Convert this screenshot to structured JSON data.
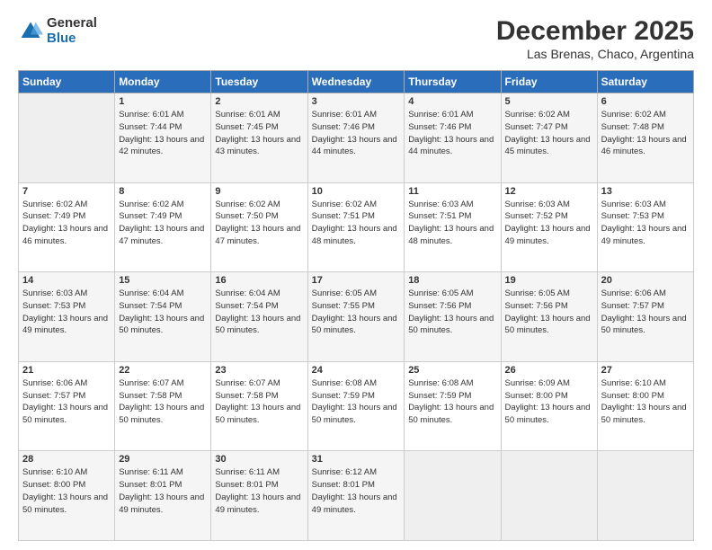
{
  "logo": {
    "general": "General",
    "blue": "Blue"
  },
  "title": "December 2025",
  "location": "Las Brenas, Chaco, Argentina",
  "days_of_week": [
    "Sunday",
    "Monday",
    "Tuesday",
    "Wednesday",
    "Thursday",
    "Friday",
    "Saturday"
  ],
  "weeks": [
    [
      {
        "day": "",
        "sunrise": "",
        "sunset": "",
        "daylight": ""
      },
      {
        "day": "1",
        "sunrise": "Sunrise: 6:01 AM",
        "sunset": "Sunset: 7:44 PM",
        "daylight": "Daylight: 13 hours and 42 minutes."
      },
      {
        "day": "2",
        "sunrise": "Sunrise: 6:01 AM",
        "sunset": "Sunset: 7:45 PM",
        "daylight": "Daylight: 13 hours and 43 minutes."
      },
      {
        "day": "3",
        "sunrise": "Sunrise: 6:01 AM",
        "sunset": "Sunset: 7:46 PM",
        "daylight": "Daylight: 13 hours and 44 minutes."
      },
      {
        "day": "4",
        "sunrise": "Sunrise: 6:01 AM",
        "sunset": "Sunset: 7:46 PM",
        "daylight": "Daylight: 13 hours and 44 minutes."
      },
      {
        "day": "5",
        "sunrise": "Sunrise: 6:02 AM",
        "sunset": "Sunset: 7:47 PM",
        "daylight": "Daylight: 13 hours and 45 minutes."
      },
      {
        "day": "6",
        "sunrise": "Sunrise: 6:02 AM",
        "sunset": "Sunset: 7:48 PM",
        "daylight": "Daylight: 13 hours and 46 minutes."
      }
    ],
    [
      {
        "day": "7",
        "sunrise": "Sunrise: 6:02 AM",
        "sunset": "Sunset: 7:49 PM",
        "daylight": "Daylight: 13 hours and 46 minutes."
      },
      {
        "day": "8",
        "sunrise": "Sunrise: 6:02 AM",
        "sunset": "Sunset: 7:49 PM",
        "daylight": "Daylight: 13 hours and 47 minutes."
      },
      {
        "day": "9",
        "sunrise": "Sunrise: 6:02 AM",
        "sunset": "Sunset: 7:50 PM",
        "daylight": "Daylight: 13 hours and 47 minutes."
      },
      {
        "day": "10",
        "sunrise": "Sunrise: 6:02 AM",
        "sunset": "Sunset: 7:51 PM",
        "daylight": "Daylight: 13 hours and 48 minutes."
      },
      {
        "day": "11",
        "sunrise": "Sunrise: 6:03 AM",
        "sunset": "Sunset: 7:51 PM",
        "daylight": "Daylight: 13 hours and 48 minutes."
      },
      {
        "day": "12",
        "sunrise": "Sunrise: 6:03 AM",
        "sunset": "Sunset: 7:52 PM",
        "daylight": "Daylight: 13 hours and 49 minutes."
      },
      {
        "day": "13",
        "sunrise": "Sunrise: 6:03 AM",
        "sunset": "Sunset: 7:53 PM",
        "daylight": "Daylight: 13 hours and 49 minutes."
      }
    ],
    [
      {
        "day": "14",
        "sunrise": "Sunrise: 6:03 AM",
        "sunset": "Sunset: 7:53 PM",
        "daylight": "Daylight: 13 hours and 49 minutes."
      },
      {
        "day": "15",
        "sunrise": "Sunrise: 6:04 AM",
        "sunset": "Sunset: 7:54 PM",
        "daylight": "Daylight: 13 hours and 50 minutes."
      },
      {
        "day": "16",
        "sunrise": "Sunrise: 6:04 AM",
        "sunset": "Sunset: 7:54 PM",
        "daylight": "Daylight: 13 hours and 50 minutes."
      },
      {
        "day": "17",
        "sunrise": "Sunrise: 6:05 AM",
        "sunset": "Sunset: 7:55 PM",
        "daylight": "Daylight: 13 hours and 50 minutes."
      },
      {
        "day": "18",
        "sunrise": "Sunrise: 6:05 AM",
        "sunset": "Sunset: 7:56 PM",
        "daylight": "Daylight: 13 hours and 50 minutes."
      },
      {
        "day": "19",
        "sunrise": "Sunrise: 6:05 AM",
        "sunset": "Sunset: 7:56 PM",
        "daylight": "Daylight: 13 hours and 50 minutes."
      },
      {
        "day": "20",
        "sunrise": "Sunrise: 6:06 AM",
        "sunset": "Sunset: 7:57 PM",
        "daylight": "Daylight: 13 hours and 50 minutes."
      }
    ],
    [
      {
        "day": "21",
        "sunrise": "Sunrise: 6:06 AM",
        "sunset": "Sunset: 7:57 PM",
        "daylight": "Daylight: 13 hours and 50 minutes."
      },
      {
        "day": "22",
        "sunrise": "Sunrise: 6:07 AM",
        "sunset": "Sunset: 7:58 PM",
        "daylight": "Daylight: 13 hours and 50 minutes."
      },
      {
        "day": "23",
        "sunrise": "Sunrise: 6:07 AM",
        "sunset": "Sunset: 7:58 PM",
        "daylight": "Daylight: 13 hours and 50 minutes."
      },
      {
        "day": "24",
        "sunrise": "Sunrise: 6:08 AM",
        "sunset": "Sunset: 7:59 PM",
        "daylight": "Daylight: 13 hours and 50 minutes."
      },
      {
        "day": "25",
        "sunrise": "Sunrise: 6:08 AM",
        "sunset": "Sunset: 7:59 PM",
        "daylight": "Daylight: 13 hours and 50 minutes."
      },
      {
        "day": "26",
        "sunrise": "Sunrise: 6:09 AM",
        "sunset": "Sunset: 8:00 PM",
        "daylight": "Daylight: 13 hours and 50 minutes."
      },
      {
        "day": "27",
        "sunrise": "Sunrise: 6:10 AM",
        "sunset": "Sunset: 8:00 PM",
        "daylight": "Daylight: 13 hours and 50 minutes."
      }
    ],
    [
      {
        "day": "28",
        "sunrise": "Sunrise: 6:10 AM",
        "sunset": "Sunset: 8:00 PM",
        "daylight": "Daylight: 13 hours and 50 minutes."
      },
      {
        "day": "29",
        "sunrise": "Sunrise: 6:11 AM",
        "sunset": "Sunset: 8:01 PM",
        "daylight": "Daylight: 13 hours and 49 minutes."
      },
      {
        "day": "30",
        "sunrise": "Sunrise: 6:11 AM",
        "sunset": "Sunset: 8:01 PM",
        "daylight": "Daylight: 13 hours and 49 minutes."
      },
      {
        "day": "31",
        "sunrise": "Sunrise: 6:12 AM",
        "sunset": "Sunset: 8:01 PM",
        "daylight": "Daylight: 13 hours and 49 minutes."
      },
      {
        "day": "",
        "sunrise": "",
        "sunset": "",
        "daylight": ""
      },
      {
        "day": "",
        "sunrise": "",
        "sunset": "",
        "daylight": ""
      },
      {
        "day": "",
        "sunrise": "",
        "sunset": "",
        "daylight": ""
      }
    ]
  ]
}
